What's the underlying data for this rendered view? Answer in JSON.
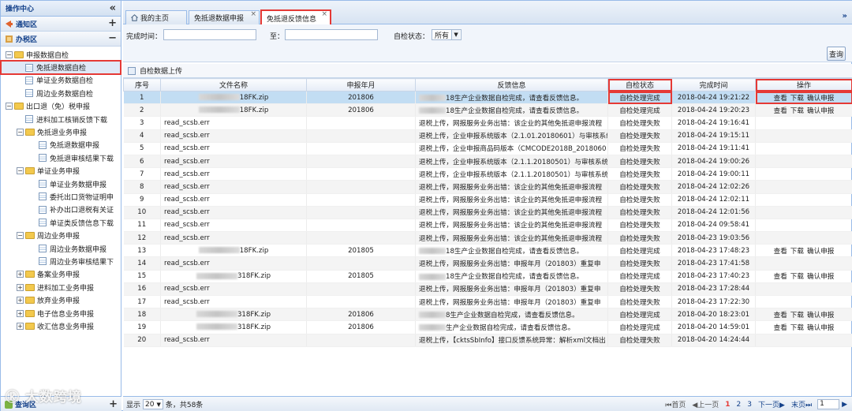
{
  "sidebar": {
    "title": "操作中心",
    "collapse_icon": "«",
    "sections": [
      {
        "label": "通知区",
        "tool": "+"
      },
      {
        "label": "办税区",
        "tool": "−"
      }
    ],
    "tree": [
      {
        "label": "申报数据自检",
        "level": 0,
        "type": "folder",
        "toggle": "−"
      },
      {
        "label": "免抵退数据自检",
        "level": 1,
        "type": "doc",
        "selected": true
      },
      {
        "label": "单证业务数据自检",
        "level": 1,
        "type": "doc"
      },
      {
        "label": "周边业务数据自检",
        "level": 1,
        "type": "doc"
      },
      {
        "label": "出口退（免）税申报",
        "level": 0,
        "type": "folder",
        "toggle": "−"
      },
      {
        "label": "进料加工核销反馈下载",
        "level": 1,
        "type": "doc"
      },
      {
        "label": "免抵退业务申报",
        "level": 1,
        "type": "folder",
        "toggle": "−"
      },
      {
        "label": "免抵退数据申报",
        "level": 2,
        "type": "doc"
      },
      {
        "label": "免抵退审核结果下载",
        "level": 2,
        "type": "doc"
      },
      {
        "label": "单证业务申报",
        "level": 1,
        "type": "folder",
        "toggle": "−"
      },
      {
        "label": "单证业务数据申报",
        "level": 2,
        "type": "doc"
      },
      {
        "label": "委托出口货物证明申",
        "level": 2,
        "type": "doc"
      },
      {
        "label": "补办出口退税有关证",
        "level": 2,
        "type": "doc"
      },
      {
        "label": "单证类反馈信息下载",
        "level": 2,
        "type": "doc"
      },
      {
        "label": "周边业务申报",
        "level": 1,
        "type": "folder",
        "toggle": "−"
      },
      {
        "label": "周边业务数据申报",
        "level": 2,
        "type": "doc"
      },
      {
        "label": "周边业务审核结果下",
        "level": 2,
        "type": "doc"
      },
      {
        "label": "备案业务申报",
        "level": 1,
        "type": "folder",
        "toggle": "+"
      },
      {
        "label": "进料加工业务申报",
        "level": 1,
        "type": "folder",
        "toggle": "+"
      },
      {
        "label": "放弃业务申报",
        "level": 1,
        "type": "folder",
        "toggle": "+"
      },
      {
        "label": "电子信息业务申报",
        "level": 1,
        "type": "folder",
        "toggle": "+"
      },
      {
        "label": "收汇信息业务申报",
        "level": 1,
        "type": "folder",
        "toggle": "+"
      }
    ],
    "bottom": {
      "label": "查询区",
      "tool": "+"
    }
  },
  "tabs": [
    {
      "label": "我的主页",
      "icon": "home-icon"
    },
    {
      "label": "免抵退数据申报",
      "close": "×"
    },
    {
      "label": "免抵退反馈信息",
      "close": "×",
      "active": true
    }
  ],
  "tab_more": "»",
  "filter": {
    "date_label": "完成时间：",
    "to_label": "至：",
    "status_label": "自检状态：",
    "status_value": "所有",
    "query_label": "查询"
  },
  "grid": {
    "toolbar_label": "自检数据上传",
    "columns": [
      "序号",
      "文件名称",
      "申报年月",
      "反馈信息",
      "自检状态",
      "完成时间",
      "操作"
    ],
    "rows": [
      {
        "no": "1",
        "file": "18FK.zip",
        "blur": true,
        "ym": "201806",
        "fb": "18生产企业数据自检完成，请查看反馈信息。",
        "fbblur": true,
        "status": "自检处理完成",
        "time": "2018-04-24 19:21:22",
        "ops": [
          "查看",
          "下载",
          "确认申报"
        ]
      },
      {
        "no": "2",
        "file": "18FK.zip",
        "blur": true,
        "ym": "201806",
        "fb": "18生产企业数据自检完成，请查看反馈信息。",
        "fbblur": true,
        "status": "自检处理完成",
        "time": "2018-04-24 19:20:23",
        "ops": [
          "查看",
          "下载",
          "确认申报"
        ]
      },
      {
        "no": "3",
        "file": "read_scsb.err",
        "ym": "",
        "fb": "退税上传，网报服务业务出错：该企业的其他免抵退申报流程",
        "status": "自检处理失败",
        "time": "2018-04-24 19:16:41",
        "ops": []
      },
      {
        "no": "4",
        "file": "read_scsb.err",
        "ym": "",
        "fb": "退税上传，企业申报系统版本（2.1.01.20180601）与审核系统",
        "status": "自检处理失败",
        "time": "2018-04-24 19:15:11",
        "ops": []
      },
      {
        "no": "5",
        "file": "read_scsb.err",
        "ym": "",
        "fb": "退税上传，企业申报商品码版本（CMCODE2018B_2018060",
        "status": "自检处理失败",
        "time": "2018-04-24 19:11:41",
        "ops": []
      },
      {
        "no": "6",
        "file": "read_scsb.err",
        "ym": "",
        "fb": "退税上传，企业申报系统版本（2.1.1.20180501）与审核系统",
        "status": "自检处理失败",
        "time": "2018-04-24 19:00:26",
        "ops": []
      },
      {
        "no": "7",
        "file": "read_scsb.err",
        "ym": "",
        "fb": "退税上传，企业申报系统版本（2.1.1.20180501）与审核系统",
        "status": "自检处理失败",
        "time": "2018-04-24 19:00:11",
        "ops": []
      },
      {
        "no": "8",
        "file": "read_scsb.err",
        "ym": "",
        "fb": "退税上传，网报服务业务出错：该企业的其他免抵退申报流程",
        "status": "自检处理失败",
        "time": "2018-04-24 12:02:26",
        "ops": []
      },
      {
        "no": "9",
        "file": "read_scsb.err",
        "ym": "",
        "fb": "退税上传，网报服务业务出错：该企业的其他免抵退申报流程",
        "status": "自检处理失败",
        "time": "2018-04-24 12:02:11",
        "ops": []
      },
      {
        "no": "10",
        "file": "read_scsb.err",
        "ym": "",
        "fb": "退税上传，网报服务业务出错：该企业的其他免抵退申报流程",
        "status": "自检处理失败",
        "time": "2018-04-24 12:01:56",
        "ops": []
      },
      {
        "no": "11",
        "file": "read_scsb.err",
        "ym": "",
        "fb": "退税上传，网报服务业务出错：该企业的其他免抵退申报流程",
        "status": "自检处理失败",
        "time": "2018-04-24 09:58:41",
        "ops": []
      },
      {
        "no": "12",
        "file": "read_scsb.err",
        "ym": "",
        "fb": "退税上传，网报服务业务出错：该企业的其他免抵退申报流程",
        "status": "自检处理失败",
        "time": "2018-04-23 19:03:56",
        "ops": []
      },
      {
        "no": "13",
        "file": "18FK.zip",
        "blur": true,
        "ym": "201805",
        "fb": "18生产企业数据自检完成，请查看反馈信息。",
        "fbblur": true,
        "status": "自检处理完成",
        "time": "2018-04-23 17:48:23",
        "ops": [
          "查看",
          "下载",
          "确认申报"
        ]
      },
      {
        "no": "14",
        "file": "read_scsb.err",
        "ym": "",
        "fb": "退税上传，网报服务业务出错：申报年月（201803）重复申",
        "status": "自检处理失败",
        "time": "2018-04-23 17:41:58",
        "ops": []
      },
      {
        "no": "15",
        "file": "318FK.zip",
        "blur": true,
        "ym": "201805",
        "fb": "18生产企业数据自检完成，请查看反馈信息。",
        "fbblur": true,
        "status": "自检处理完成",
        "time": "2018-04-23 17:40:23",
        "ops": [
          "查看",
          "下载",
          "确认申报"
        ]
      },
      {
        "no": "16",
        "file": "read_scsb.err",
        "ym": "",
        "fb": "退税上传，网报服务业务出错：申报年月（201803）重复申",
        "status": "自检处理失败",
        "time": "2018-04-23 17:28:44",
        "ops": []
      },
      {
        "no": "17",
        "file": "read_scsb.err",
        "ym": "",
        "fb": "退税上传，网报服务业务出错：申报年月（201803）重复申",
        "status": "自检处理失败",
        "time": "2018-04-23 17:22:30",
        "ops": []
      },
      {
        "no": "18",
        "file": "318FK.zip",
        "blur": true,
        "ym": "201806",
        "fb": "8生产企业数据自检完成，请查看反馈信息。",
        "fbblur": true,
        "status": "自检处理完成",
        "time": "2018-04-20 18:23:01",
        "ops": [
          "查看",
          "下载",
          "确认申报"
        ]
      },
      {
        "no": "19",
        "file": "318FK.zip",
        "blur": true,
        "ym": "201806",
        "fb": "生产企业数据自检完成，请查看反馈信息。",
        "fbblur": true,
        "status": "自检处理完成",
        "time": "2018-04-20 14:59:01",
        "ops": [
          "查看",
          "下载",
          "确认申报"
        ]
      },
      {
        "no": "20",
        "file": "read_scsb.err",
        "ym": "",
        "fb": "退税上传，【cktsSbInfo】接口反馈系统异常：解析xml文档出",
        "status": "自检处理失败",
        "time": "2018-04-20 14:24:44",
        "ops": []
      }
    ]
  },
  "footer": {
    "show_label": "显示",
    "page_size": "20",
    "total_label": "条，共58条",
    "first": "首页",
    "prev": "上一页",
    "pages": [
      "1",
      "2",
      "3"
    ],
    "next": "下一页",
    "last": "末页",
    "page_input": "1"
  },
  "watermark": "大数跨境",
  "colors": {
    "highlight_box": "#e53935",
    "selected_row": "#c2ddf3",
    "accent": "#15428b"
  }
}
